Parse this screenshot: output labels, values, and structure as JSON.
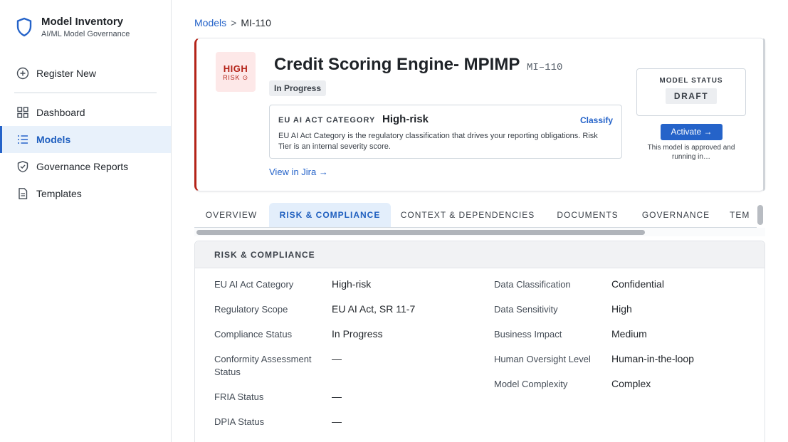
{
  "sidebar": {
    "brand_title": "Model Inventory",
    "brand_subtitle": "AI/ML Model Governance",
    "register_label": "Register New",
    "items": [
      {
        "label": "Dashboard"
      },
      {
        "label": "Models"
      },
      {
        "label": "Governance Reports"
      },
      {
        "label": "Templates"
      }
    ]
  },
  "breadcrumb": {
    "parent": "Models",
    "separator": ">",
    "current": "MI-110"
  },
  "model": {
    "risk_badge_main": "HIGH",
    "risk_badge_sub": "RISK",
    "title": "Credit Scoring Engine- MPIMP",
    "id": "MI–110",
    "status_pill": "In Progress",
    "eu_ai": {
      "label": "EU AI ACT CATEGORY",
      "value": "High-risk",
      "action": "Classify",
      "description": "EU AI Act Category is the regulatory classification that drives your reporting obligations. Risk Tier is an internal severity score."
    },
    "jira_link": "View in Jira →",
    "status_box": {
      "label": "MODEL STATUS",
      "value": "DRAFT"
    },
    "activate_label": "Activate →",
    "activate_note": "This model is approved and running in…"
  },
  "tabs": [
    {
      "label": "OVERVIEW"
    },
    {
      "label": "RISK & COMPLIANCE"
    },
    {
      "label": "CONTEXT & DEPENDENCIES"
    },
    {
      "label": "DOCUMENTS"
    },
    {
      "label": "GOVERNANCE"
    },
    {
      "label": "TEM"
    }
  ],
  "section": {
    "title": "RISK & COMPLIANCE",
    "left_fields": [
      {
        "label": "EU AI Act Category",
        "value": "High-risk"
      },
      {
        "label": "Regulatory Scope",
        "value": "EU AI Act, SR 11-7"
      },
      {
        "label": "Compliance Status",
        "value": "In Progress"
      },
      {
        "label": "Conformity Assessment Status",
        "value": "—"
      },
      {
        "label": "FRIA Status",
        "value": "—"
      },
      {
        "label": "DPIA Status",
        "value": "—"
      }
    ],
    "right_fields": [
      {
        "label": "Data Classification",
        "value": "Confidential"
      },
      {
        "label": "Data Sensitivity",
        "value": "High"
      },
      {
        "label": "Business Impact",
        "value": "Medium"
      },
      {
        "label": "Human Oversight Level",
        "value": "Human-in-the-loop"
      },
      {
        "label": "Model Complexity",
        "value": "Complex"
      }
    ]
  },
  "colors": {
    "accent": "#2563c9",
    "risk": "#b42318",
    "active_bg": "#e8f1fb"
  }
}
